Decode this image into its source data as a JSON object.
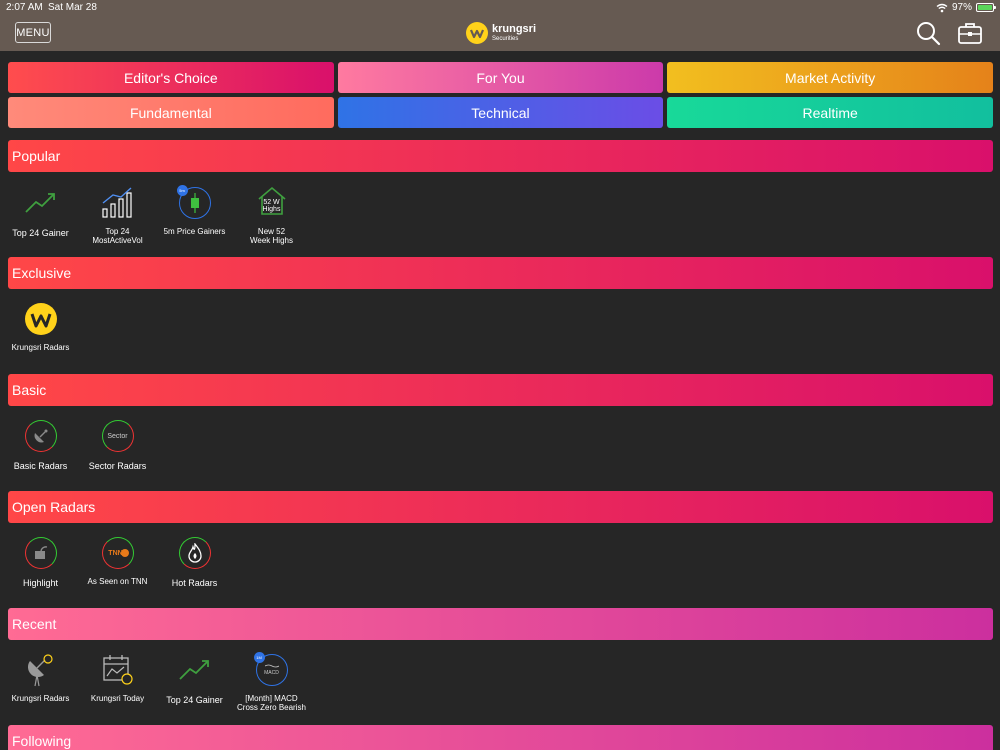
{
  "status": {
    "time": "2:07 AM",
    "date": "Sat Mar 28",
    "battery": "97%",
    "battery_level": 0.97
  },
  "header": {
    "menu_label": "MENU",
    "brand_name": "krungsri",
    "brand_sub": "Securities"
  },
  "tiles": [
    {
      "label": "Editor's Choice",
      "from": "#ff4d4d",
      "to": "#d9106b"
    },
    {
      "label": "For You",
      "from": "#ff7aa0",
      "to": "#cc3aaa"
    },
    {
      "label": "Market Activity",
      "from": "#f2bf1f",
      "to": "#e5821a"
    },
    {
      "label": "Fundamental",
      "from": "#ff8a7a",
      "to": "#ff6b5e"
    },
    {
      "label": "Technical",
      "from": "#2f73e6",
      "to": "#6b4de6"
    },
    {
      "label": "Realtime",
      "from": "#18d999",
      "to": "#12bf9e"
    }
  ],
  "sections": {
    "popular": {
      "title": "Popular",
      "items": [
        {
          "label": "Top 24 Gainer"
        },
        {
          "label": "Top 24\nMostActiveVol"
        },
        {
          "label": "5m Price Gainers",
          "badge": "5m"
        },
        {
          "label": "New 52\nWeek Highs",
          "icon_text": "52 W\nHighs"
        }
      ]
    },
    "exclusive": {
      "title": "Exclusive",
      "items": [
        {
          "label": "Krungsri Radars"
        }
      ]
    },
    "basic": {
      "title": "Basic",
      "items": [
        {
          "label": "Basic Radars"
        },
        {
          "label": "Sector Radars",
          "icon_text": "Sector"
        }
      ]
    },
    "open_radars": {
      "title": "Open Radars",
      "items": [
        {
          "label": "Highlight"
        },
        {
          "label": "As Seen on TNN",
          "icon_text": "TNN"
        },
        {
          "label": "Hot Radars"
        }
      ]
    },
    "recent": {
      "title": "Recent",
      "items": [
        {
          "label": "Krungsri Radars"
        },
        {
          "label": "Krungsri Today"
        },
        {
          "label": "Top 24 Gainer"
        },
        {
          "label": "[Month] MACD\nCross Zero Bearish",
          "badge": "1M",
          "icon_text": "MACD"
        }
      ]
    },
    "following": {
      "title": "Following"
    }
  },
  "icons": {
    "search": "search-icon",
    "portfolio": "briefcase-icon",
    "wifi": "wifi-icon",
    "logo": "krungsri-logo-icon"
  },
  "colors": {
    "header_bg": "#665a52",
    "page_bg": "#262626",
    "gain_green": "#3fa03f",
    "logo_yellow": "#ffd21a",
    "ring_red": "#e33",
    "ring_green": "#3c3"
  }
}
